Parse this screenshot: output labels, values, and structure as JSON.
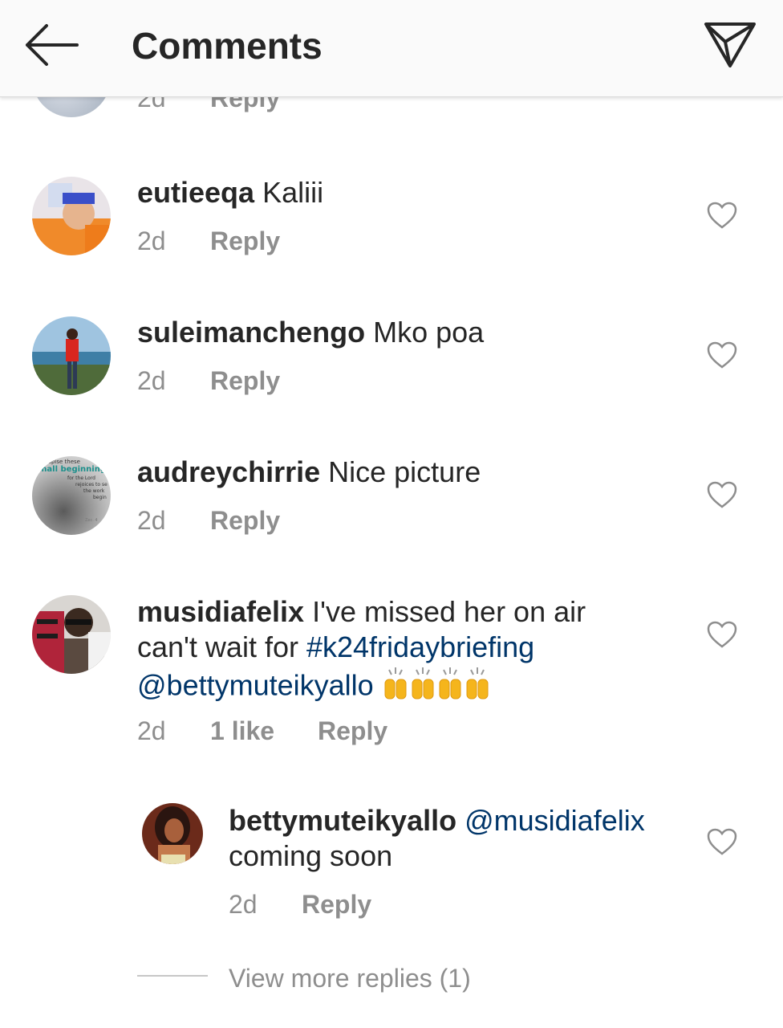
{
  "header": {
    "title": "Comments",
    "back_icon": "arrow-left-icon",
    "send_icon": "send-paper-plane-icon"
  },
  "partial_comment": {
    "time": "2d",
    "reply": "Reply"
  },
  "comments": [
    {
      "username": "eutieeqa",
      "text": "Kaliii",
      "time": "2d",
      "reply": "Reply"
    },
    {
      "username": "suleimanchengo",
      "text": "Mko poa",
      "time": "2d",
      "reply": "Reply"
    },
    {
      "username": "audreychirrie",
      "text": "Nice picture",
      "time": "2d",
      "reply": "Reply",
      "avatar_text": [
        "espise these",
        "mall beginning",
        "for the Lord",
        "rejoices to se",
        "the work",
        "begin",
        "Zec. 4"
      ]
    },
    {
      "username": "musidiafelix",
      "text_line1": "I've missed her on air",
      "text_line2_prefix": "can't wait for ",
      "hashtag": "#k24fridaybriefing",
      "mention": "@bettymuteikyallo",
      "time": "2d",
      "likes": "1 like",
      "reply": "Reply"
    }
  ],
  "reply_comment": {
    "username": "bettymuteikyallo",
    "mention": "@musidiafelix",
    "text": "coming soon",
    "time": "2d",
    "reply": "Reply"
  },
  "view_more": "View more replies (1)",
  "colors": {
    "text": "#262626",
    "muted": "#8e8e8e",
    "link": "#003569",
    "header_bg": "#fafafa"
  }
}
